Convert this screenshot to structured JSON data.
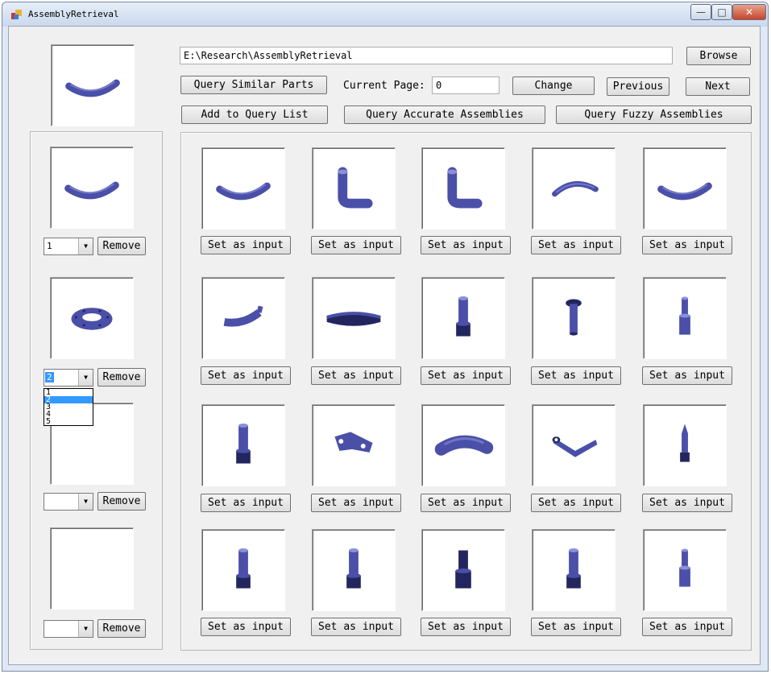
{
  "window": {
    "title": "AssemblyRetrieval",
    "controls": [
      "—",
      "□",
      "✕"
    ]
  },
  "toolbar": {
    "path_value": "E:\\Research\\AssemblyRetrieval",
    "browse_label": "Browse",
    "query_similar_label": "Query Similar Parts",
    "current_page_label": "Current Page:",
    "current_page_value": "0",
    "change_label": "Change",
    "previous_label": "Previous",
    "next_label": "Next",
    "add_query_label": "Add to Query List",
    "query_accurate_label": "Query Accurate Assemblies",
    "query_fuzzy_label": "Query Fuzzy Assemblies"
  },
  "query_list": {
    "remove_label": "Remove",
    "slots": [
      {
        "shape": "curved-rod",
        "selected": "1"
      },
      {
        "shape": "flange-ring",
        "selected": "2"
      },
      {
        "shape": "empty",
        "selected": ""
      },
      {
        "shape": "empty",
        "selected": ""
      }
    ],
    "open_dropdown_options": [
      "1",
      "2",
      "3",
      "4",
      "5"
    ],
    "open_dropdown_highlighted": "2"
  },
  "results": {
    "set_input_label": "Set as input",
    "parts": [
      "curved-rod",
      "l-pipe",
      "l-pipe",
      "arc-rod",
      "curved-rod",
      "curved-clip",
      "arc-plate",
      "bolt",
      "rivet",
      "pin",
      "bolt",
      "bracket",
      "bent-tube",
      "lever-arm",
      "tapered-pin",
      "bolt",
      "bolt",
      "hex-bolt",
      "bolt",
      "pin"
    ]
  },
  "colors": {
    "part_fill": "#4a4fa8",
    "part_highlight": "#8a8fd8",
    "part_dark": "#23265e"
  }
}
